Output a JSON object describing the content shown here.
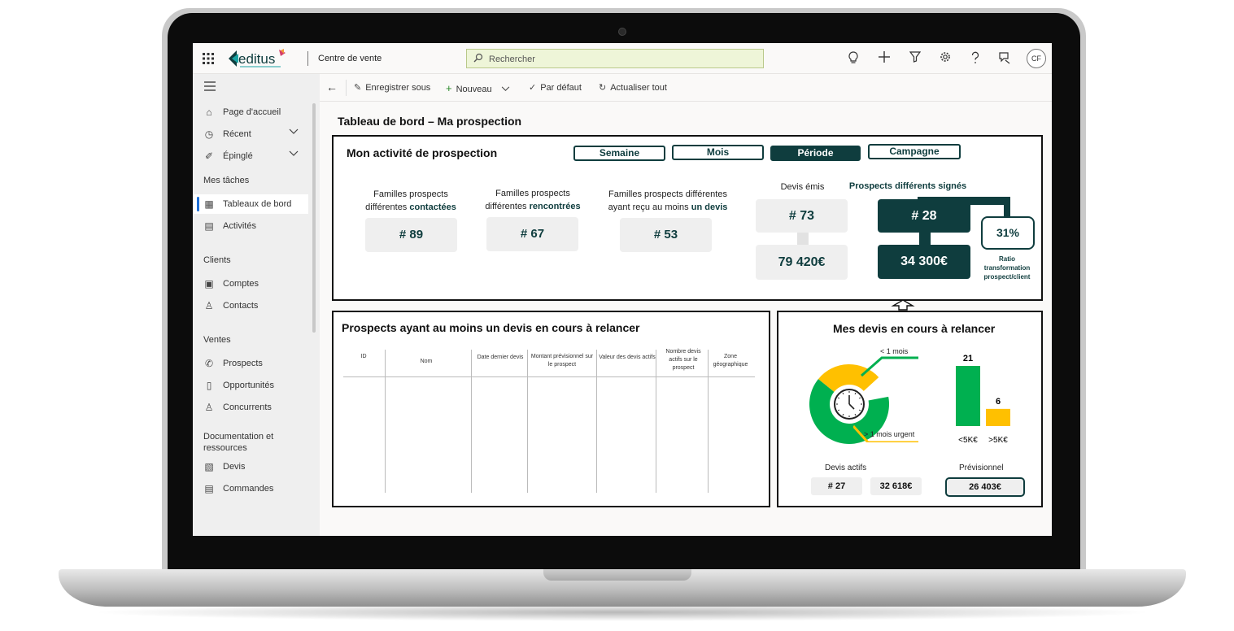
{
  "topbar": {
    "app_name": "Centre de vente",
    "search_placeholder": "Rechercher",
    "avatar_initials": "CF",
    "logo_text": "editus"
  },
  "sidebar": {
    "items": [
      {
        "label": "Page d'accueil"
      },
      {
        "label": "Récent"
      },
      {
        "label": "Épinglé"
      }
    ],
    "group_tasks": "Mes tâches",
    "tasks": [
      {
        "label": "Tableaux de bord"
      },
      {
        "label": "Activités"
      }
    ],
    "group_clients": "Clients",
    "clients": [
      {
        "label": "Comptes"
      },
      {
        "label": "Contacts"
      }
    ],
    "group_ventes": "Ventes",
    "ventes": [
      {
        "label": "Prospects"
      },
      {
        "label": "Opportunités"
      },
      {
        "label": "Concurrents"
      }
    ],
    "group_docs": "Documentation et ressources",
    "docs": [
      {
        "label": "Devis"
      },
      {
        "label": "Commandes"
      }
    ]
  },
  "commandbar": {
    "save_as": "Enregistrer sous",
    "new": "Nouveau",
    "default": "Par défaut",
    "refresh": "Actualiser tout"
  },
  "dashboard": {
    "title": "Tableau de bord – Ma prospection",
    "activity": {
      "title": "Mon activité de prospection",
      "periods": [
        "Semaine",
        "Mois",
        "Période",
        "Campagne"
      ],
      "selected_period": "Période",
      "contacted_label_1": "Familles prospects",
      "contacted_label_2": "différentes",
      "contacted_label_bold": "contactées",
      "contacted_value": "# 89",
      "met_label_1": "Familles prospects",
      "met_label_2": "différentes",
      "met_label_bold": "rencontrées",
      "met_value": "# 67",
      "quote_label_1": "Familles prospects différentes",
      "quote_label_2": "ayant reçu au moins",
      "quote_label_bold": "un devis",
      "quote_value": "# 53",
      "devis_emis_label": "Devis émis",
      "devis_emis_count": "# 73",
      "devis_emis_amount": "79 420€",
      "signed_label": "Prospects différents signés",
      "signed_count": "# 28",
      "signed_amount": "34 300€",
      "ratio_value": "31%",
      "ratio_label": "Ratio transformation prospect/client"
    },
    "prospects_table": {
      "title": "Prospects ayant au moins un devis en cours à relancer",
      "columns": [
        "ID",
        "Nom",
        "Date dernier devis",
        "Montant prévisionnel sur le prospect",
        "Valeur des devis actifs",
        "Nombre devis actifs sur le prospect",
        "Zone géographique"
      ]
    },
    "devis_relance": {
      "title": "Mes devis en cours à relancer",
      "donut_label_green": "< 1 mois",
      "donut_label_yellow": "> 1 mois urgent",
      "active_label": "Devis actifs",
      "active_count": "# 27",
      "active_amount": "32 618€",
      "forecast_label": "Prévisionnel",
      "forecast_amount": "26 403€"
    }
  },
  "colors": {
    "dark_teal": "#0f3d3e",
    "green": "#00b050",
    "yellow": "#ffc000",
    "search_bg": "#eef5d8"
  },
  "chart_data": [
    {
      "type": "pie",
      "categories": [
        "< 1 mois",
        "> 1 mois urgent"
      ],
      "values": [
        0.7,
        0.3
      ],
      "title": ""
    },
    {
      "type": "bar",
      "categories": [
        "<5K€",
        ">5K€"
      ],
      "values": [
        21,
        6
      ],
      "title": ""
    }
  ]
}
